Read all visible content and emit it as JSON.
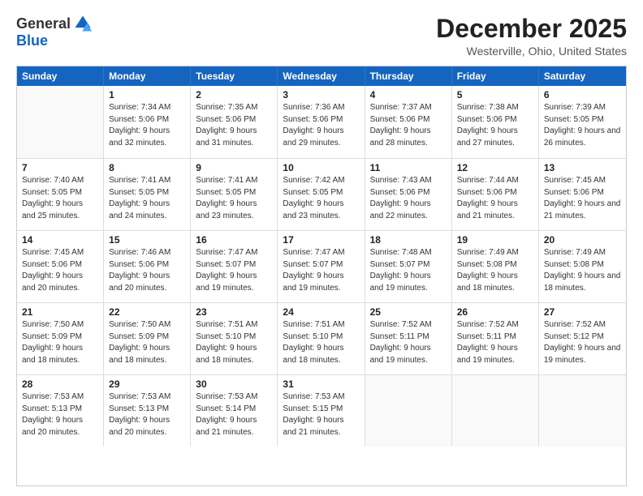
{
  "logo": {
    "general": "General",
    "blue": "Blue"
  },
  "title": "December 2025",
  "location": "Westerville, Ohio, United States",
  "days_of_week": [
    "Sunday",
    "Monday",
    "Tuesday",
    "Wednesday",
    "Thursday",
    "Friday",
    "Saturday"
  ],
  "weeks": [
    [
      {
        "day": "",
        "empty": true
      },
      {
        "day": "1",
        "sunrise": "7:34 AM",
        "sunset": "5:06 PM",
        "daylight": "9 hours and 32 minutes."
      },
      {
        "day": "2",
        "sunrise": "7:35 AM",
        "sunset": "5:06 PM",
        "daylight": "9 hours and 31 minutes."
      },
      {
        "day": "3",
        "sunrise": "7:36 AM",
        "sunset": "5:06 PM",
        "daylight": "9 hours and 29 minutes."
      },
      {
        "day": "4",
        "sunrise": "7:37 AM",
        "sunset": "5:06 PM",
        "daylight": "9 hours and 28 minutes."
      },
      {
        "day": "5",
        "sunrise": "7:38 AM",
        "sunset": "5:06 PM",
        "daylight": "9 hours and 27 minutes."
      },
      {
        "day": "6",
        "sunrise": "7:39 AM",
        "sunset": "5:05 PM",
        "daylight": "9 hours and 26 minutes."
      }
    ],
    [
      {
        "day": "7",
        "sunrise": "7:40 AM",
        "sunset": "5:05 PM",
        "daylight": "9 hours and 25 minutes."
      },
      {
        "day": "8",
        "sunrise": "7:41 AM",
        "sunset": "5:05 PM",
        "daylight": "9 hours and 24 minutes."
      },
      {
        "day": "9",
        "sunrise": "7:41 AM",
        "sunset": "5:05 PM",
        "daylight": "9 hours and 23 minutes."
      },
      {
        "day": "10",
        "sunrise": "7:42 AM",
        "sunset": "5:05 PM",
        "daylight": "9 hours and 23 minutes."
      },
      {
        "day": "11",
        "sunrise": "7:43 AM",
        "sunset": "5:06 PM",
        "daylight": "9 hours and 22 minutes."
      },
      {
        "day": "12",
        "sunrise": "7:44 AM",
        "sunset": "5:06 PM",
        "daylight": "9 hours and 21 minutes."
      },
      {
        "day": "13",
        "sunrise": "7:45 AM",
        "sunset": "5:06 PM",
        "daylight": "9 hours and 21 minutes."
      }
    ],
    [
      {
        "day": "14",
        "sunrise": "7:45 AM",
        "sunset": "5:06 PM",
        "daylight": "9 hours and 20 minutes."
      },
      {
        "day": "15",
        "sunrise": "7:46 AM",
        "sunset": "5:06 PM",
        "daylight": "9 hours and 20 minutes."
      },
      {
        "day": "16",
        "sunrise": "7:47 AM",
        "sunset": "5:07 PM",
        "daylight": "9 hours and 19 minutes."
      },
      {
        "day": "17",
        "sunrise": "7:47 AM",
        "sunset": "5:07 PM",
        "daylight": "9 hours and 19 minutes."
      },
      {
        "day": "18",
        "sunrise": "7:48 AM",
        "sunset": "5:07 PM",
        "daylight": "9 hours and 19 minutes."
      },
      {
        "day": "19",
        "sunrise": "7:49 AM",
        "sunset": "5:08 PM",
        "daylight": "9 hours and 18 minutes."
      },
      {
        "day": "20",
        "sunrise": "7:49 AM",
        "sunset": "5:08 PM",
        "daylight": "9 hours and 18 minutes."
      }
    ],
    [
      {
        "day": "21",
        "sunrise": "7:50 AM",
        "sunset": "5:09 PM",
        "daylight": "9 hours and 18 minutes."
      },
      {
        "day": "22",
        "sunrise": "7:50 AM",
        "sunset": "5:09 PM",
        "daylight": "9 hours and 18 minutes."
      },
      {
        "day": "23",
        "sunrise": "7:51 AM",
        "sunset": "5:10 PM",
        "daylight": "9 hours and 18 minutes."
      },
      {
        "day": "24",
        "sunrise": "7:51 AM",
        "sunset": "5:10 PM",
        "daylight": "9 hours and 18 minutes."
      },
      {
        "day": "25",
        "sunrise": "7:52 AM",
        "sunset": "5:11 PM",
        "daylight": "9 hours and 19 minutes."
      },
      {
        "day": "26",
        "sunrise": "7:52 AM",
        "sunset": "5:11 PM",
        "daylight": "9 hours and 19 minutes."
      },
      {
        "day": "27",
        "sunrise": "7:52 AM",
        "sunset": "5:12 PM",
        "daylight": "9 hours and 19 minutes."
      }
    ],
    [
      {
        "day": "28",
        "sunrise": "7:53 AM",
        "sunset": "5:13 PM",
        "daylight": "9 hours and 20 minutes."
      },
      {
        "day": "29",
        "sunrise": "7:53 AM",
        "sunset": "5:13 PM",
        "daylight": "9 hours and 20 minutes."
      },
      {
        "day": "30",
        "sunrise": "7:53 AM",
        "sunset": "5:14 PM",
        "daylight": "9 hours and 21 minutes."
      },
      {
        "day": "31",
        "sunrise": "7:53 AM",
        "sunset": "5:15 PM",
        "daylight": "9 hours and 21 minutes."
      },
      {
        "day": "",
        "empty": true
      },
      {
        "day": "",
        "empty": true
      },
      {
        "day": "",
        "empty": true
      }
    ]
  ]
}
